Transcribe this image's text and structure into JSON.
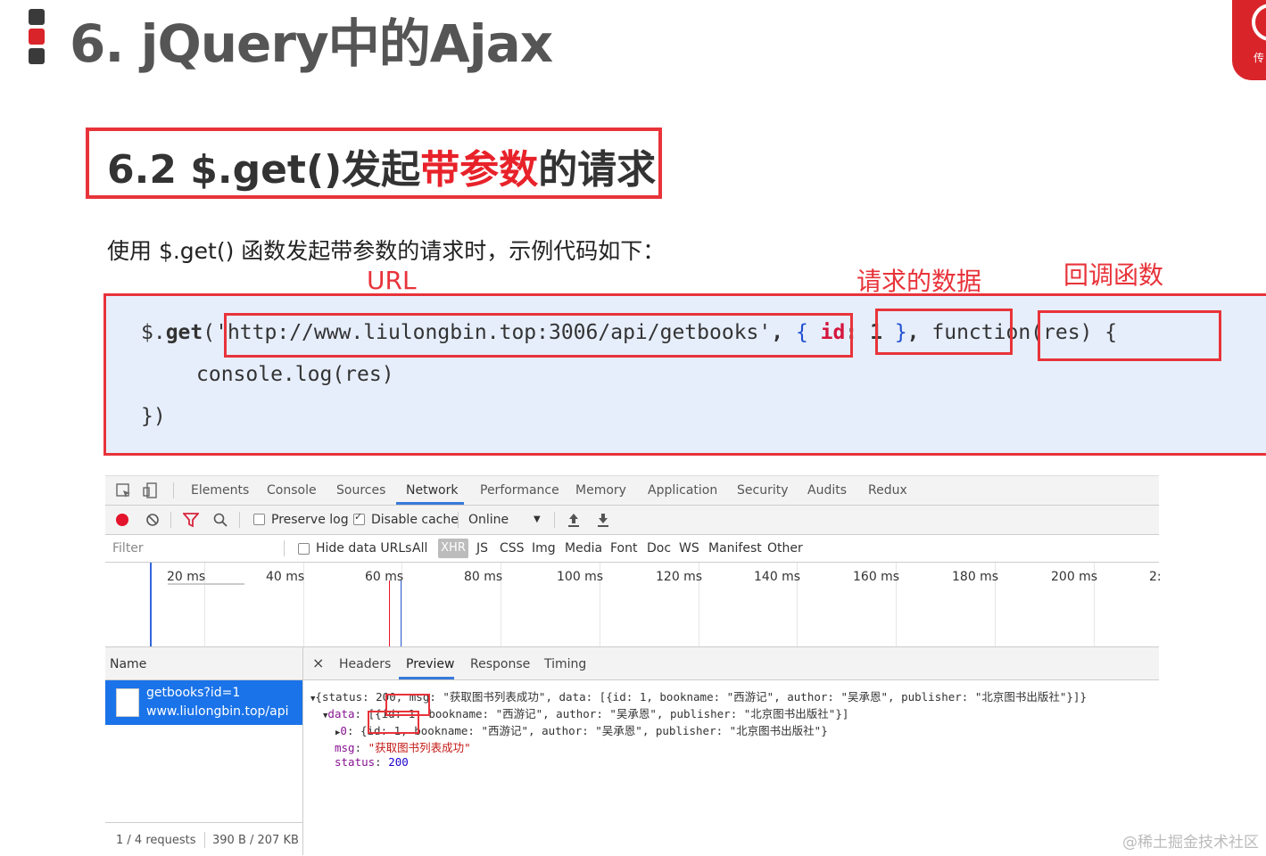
{
  "slide": {
    "title": "6. jQuery中的Ajax",
    "subtitle_pre": "6.2 $.get()发起",
    "subtitle_highlight": "带参数",
    "subtitle_post": "的请求",
    "description": "使用 $.get() 函数发起带参数的请求时，示例代码如下：",
    "logo_text": "传"
  },
  "annotations": {
    "url": "URL",
    "data": "请求的数据",
    "callback": "回调函数"
  },
  "code": {
    "line1_prefix": "$.",
    "line1_get": "get",
    "line1_paren": "(",
    "url": "'http://www.liulongbin.top:3006/api/getbooks'",
    "comma1": ",",
    "obj_open": "{",
    "obj_key": "id",
    "obj_colon": ":",
    "obj_val": "1",
    "obj_close": "}",
    "comma2": ",",
    "func": "function(res)",
    "brace_open": "{",
    "line2": "console.log(res)",
    "line3": "})"
  },
  "devtools": {
    "tabs": [
      "Elements",
      "Console",
      "Sources",
      "Network",
      "Performance",
      "Memory",
      "Application",
      "Security",
      "Audits",
      "Redux"
    ],
    "active_tab": "Network",
    "toolbar": {
      "preserve_log": "Preserve log",
      "disable_cache": "Disable cache",
      "throttle": "Online",
      "throttle_arrow": "▼"
    },
    "filter": {
      "placeholder": "Filter",
      "hide_data_urls": "Hide data URLs",
      "types": [
        "All",
        "XHR",
        "JS",
        "CSS",
        "Img",
        "Media",
        "Font",
        "Doc",
        "WS",
        "Manifest",
        "Other"
      ]
    },
    "timeline_ticks": [
      "20 ms",
      "40 ms",
      "60 ms",
      "80 ms",
      "100 ms",
      "120 ms",
      "140 ms",
      "160 ms",
      "180 ms",
      "200 ms",
      "2:"
    ],
    "name_header": "Name",
    "request": {
      "name": "getbooks?id=1",
      "host": "www.liulongbin.top/api"
    },
    "status": {
      "requests": "1 / 4 requests",
      "size": "390 B / 207 KB"
    },
    "panel_close": "×",
    "panel_tabs": [
      "Headers",
      "Preview",
      "Response",
      "Timing"
    ],
    "active_panel_tab": "Preview",
    "preview": {
      "line1": "{status: 200, msg: \"获取图书列表成功\", data: [{id: 1, bookname: \"西游记\", author: \"吴承恩\", publisher: \"北京图书出版社\"}]}",
      "line2_key": "data",
      "line2_rest": ": [{id: 1, bookname: \"西游记\", author: \"吴承恩\", publisher: \"北京图书出版社\"}]",
      "line3_key": "0",
      "line3_rest": ": {id: 1, bookname: \"西游记\", author: \"吴承恩\", publisher: \"北京图书出版社\"}",
      "msg_key": "msg",
      "msg_val": "\"获取图书列表成功\"",
      "status_key": "status",
      "status_val": "200"
    }
  },
  "watermark": "@稀土掘金技术社区",
  "colors": {
    "accent_red": "#e8333a",
    "code_bg": "#e6eefc",
    "devtools_blue": "#1a73e8"
  }
}
